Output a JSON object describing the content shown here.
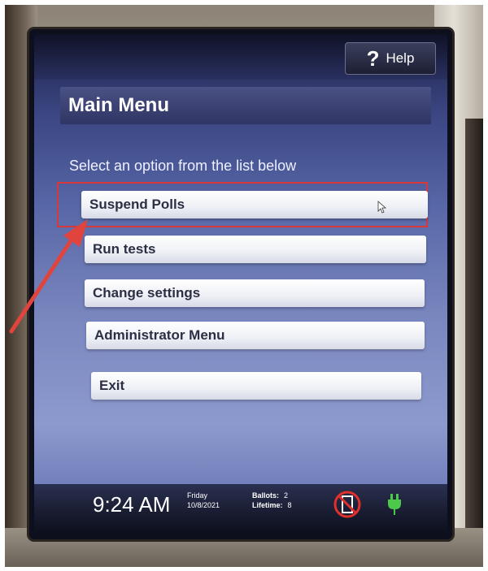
{
  "header": {
    "help_label": "Help",
    "help_icon": "question-mark-icon"
  },
  "main": {
    "title": "Main Menu",
    "instruction": "Select an option from the list below",
    "menu_items": [
      {
        "label": "Suspend Polls"
      },
      {
        "label": "Run tests"
      },
      {
        "label": "Change settings"
      },
      {
        "label": "Administrator Menu"
      },
      {
        "label": "Exit"
      }
    ],
    "highlighted_item": "Suspend Polls",
    "highlight_color": "#d8383a"
  },
  "status": {
    "time": "9:24 AM",
    "day": "Friday",
    "date": "10/8/2021",
    "ballots_label": "Ballots:",
    "ballots_value": "2",
    "lifetime_label": "Lifetime:",
    "lifetime_value": "8",
    "icons": [
      "no-paper-icon",
      "power-plug-icon"
    ]
  },
  "annotation": {
    "arrow_color": "#e0443c"
  }
}
